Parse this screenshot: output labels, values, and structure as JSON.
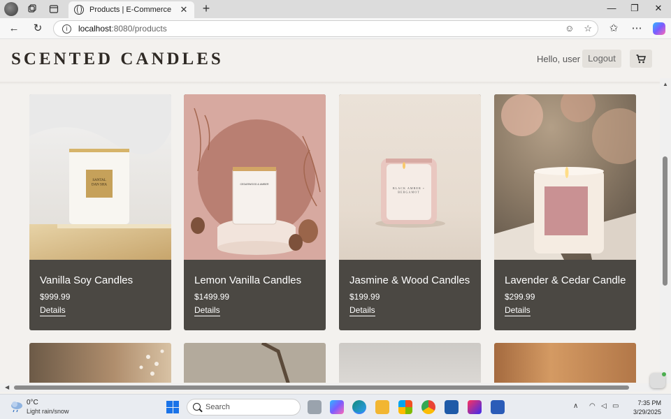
{
  "browser": {
    "tab_title": "Products | E-Commerce",
    "tab_close": "✕",
    "new_tab": "+",
    "url_host": "localhost",
    "url_path": ":8080/products",
    "window_controls": [
      "—",
      "❐",
      "✕"
    ]
  },
  "header": {
    "brand": "SCENTED CANDLES",
    "greeting": "Hello, user",
    "logout_label": "Logout"
  },
  "products": [
    {
      "name": "Vanilla Soy Candles",
      "price": "$999.99",
      "details_label": "Details"
    },
    {
      "name": "Lemon Vanilla Candles",
      "price": "$1499.99",
      "details_label": "Details"
    },
    {
      "name": "Jasmine & Wood Candles",
      "price": "$199.99",
      "details_label": "Details"
    },
    {
      "name": "Lavender  & Cedar Candle",
      "price": "$299.99",
      "details_label": "Details"
    }
  ],
  "product_image_text": {
    "candle1_label": "SANTAL\nDAN SHA",
    "candle2_label": "CEDARWOOD & AMBER",
    "candle3_label": "BLACK AMBER +\nBERGAMOT"
  },
  "taskbar": {
    "temperature": "0°C",
    "weather": "Light rain/snow",
    "search_placeholder": "Search",
    "time": "7:35 PM",
    "date": "3/29/2025"
  },
  "colors": {
    "page_bg": "#f3f1ee",
    "card_footer": "#4b4843",
    "brand_text": "#2f2a25"
  }
}
